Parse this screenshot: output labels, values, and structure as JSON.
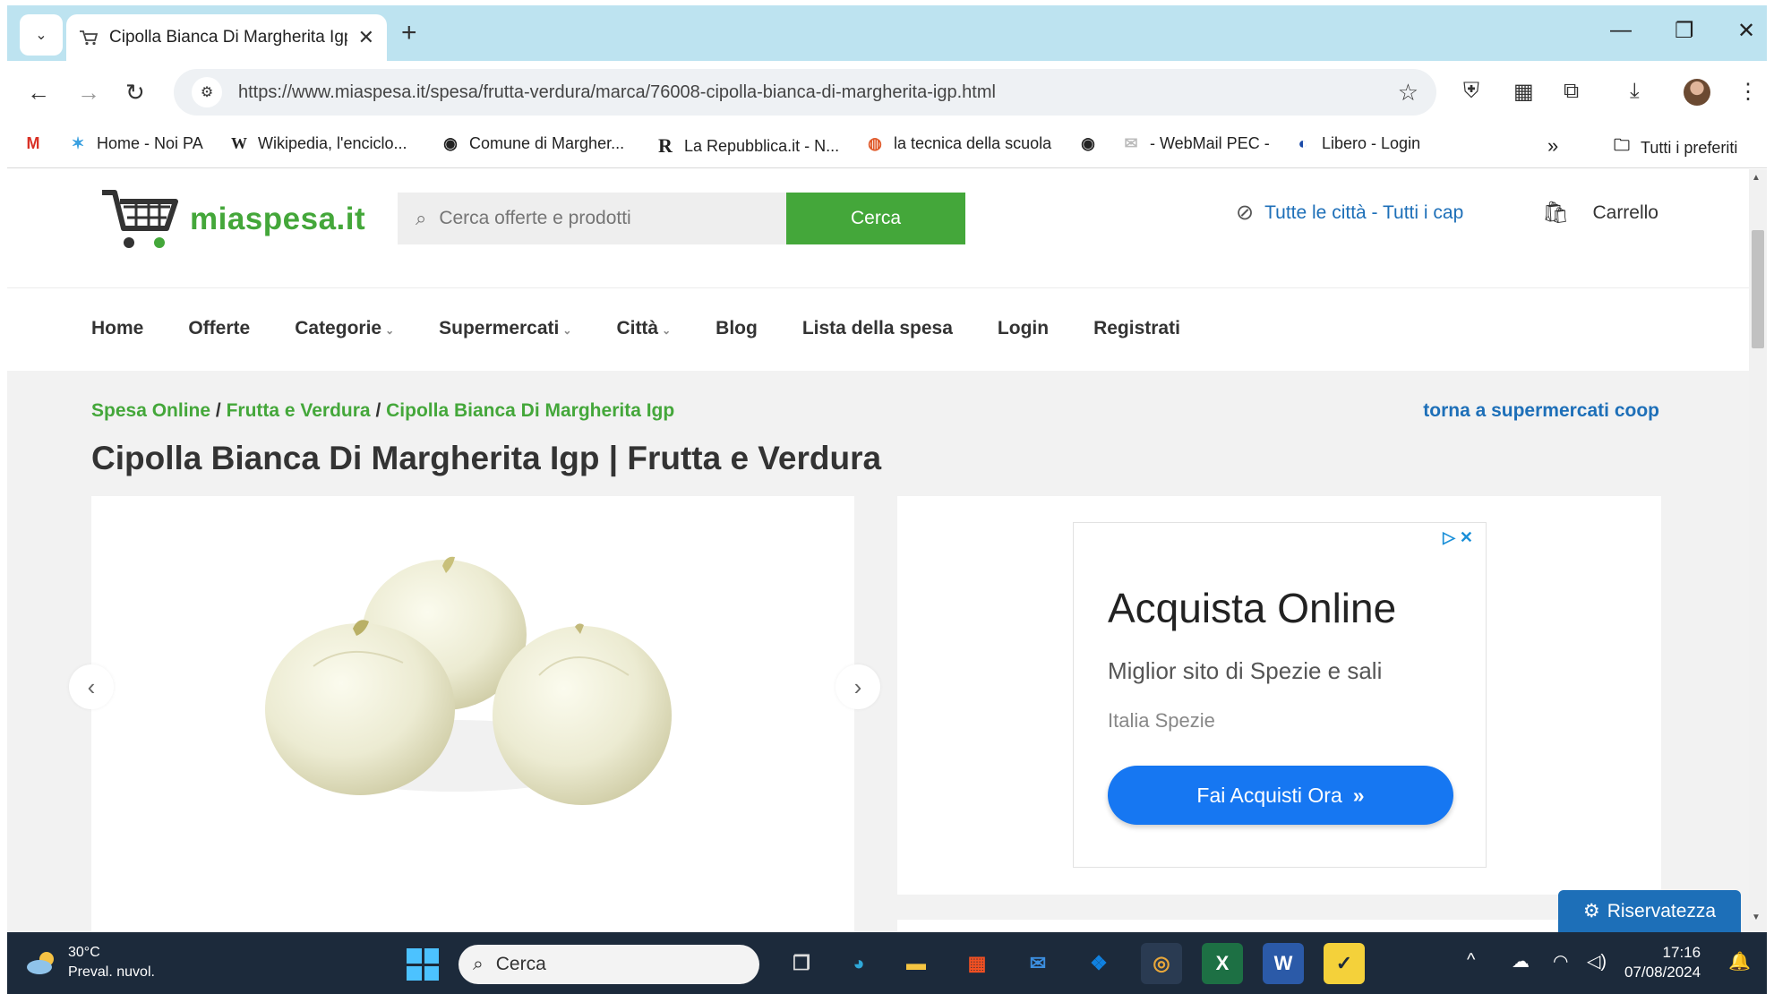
{
  "browser": {
    "tab_title": "Cipolla Bianca Di Margherita Igp",
    "url": "https://www.miaspesa.it/spesa/frutta-verdura/marca/76008-cipolla-bianca-di-margherita-igp.html",
    "bookmarks": [
      {
        "label": "Home - Noi PA"
      },
      {
        "label": "Wikipedia, l'enciclo..."
      },
      {
        "label": "Comune di Margher..."
      },
      {
        "label": "La Repubblica.it - N..."
      },
      {
        "label": "la tecnica della scuola"
      },
      {
        "label": ""
      },
      {
        "label": "- WebMail PEC -"
      },
      {
        "label": "Libero - Login"
      }
    ],
    "all_bookmarks_label": "Tutti i preferiti"
  },
  "site": {
    "logo_text": "miaspesa.it",
    "search_placeholder": "Cerca offerte e prodotti",
    "search_button": "Cerca",
    "city_link": "Tutte le città - Tutti i cap",
    "cart_label": "Carrello",
    "nav": [
      "Home",
      "Offerte",
      "Categorie",
      "Supermercati",
      "Città",
      "Blog",
      "Lista della spesa",
      "Login",
      "Registrati"
    ],
    "breadcrumb": [
      "Spesa Online",
      "Frutta e Verdura",
      "Cipolla Bianca Di Margherita Igp"
    ],
    "breadcrumb_sep": " / ",
    "back_link": "torna a supermercati coop",
    "page_title": "Cipolla Bianca Di Margherita Igp | Frutta e Verdura",
    "privacy_button": "Riservatezza"
  },
  "ad": {
    "title": "Acquista Online",
    "subtitle": "Miglior sito di Spezie e sali",
    "brand": "Italia Spezie",
    "cta": "Fai Acquisti Ora"
  },
  "taskbar": {
    "temperature": "30°C",
    "weather": "Preval. nuvol.",
    "search_label": "Cerca",
    "time": "17:16",
    "date": "07/08/2024"
  },
  "colors": {
    "brand_green": "#44a73a",
    "link_blue": "#1d6fb8",
    "ad_button": "#1677f2",
    "tab_strip": "#bde3f0"
  }
}
